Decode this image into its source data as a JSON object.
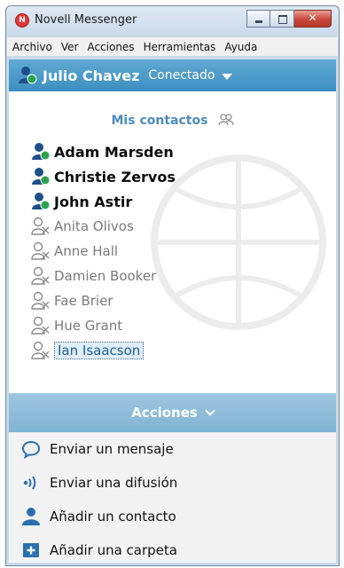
{
  "window": {
    "title": "Novell Messenger",
    "app_icon": "novell-icon"
  },
  "menu": [
    "Archivo",
    "Ver",
    "Acciones",
    "Herramientas",
    "Ayuda"
  ],
  "user": {
    "name": "Julio Chavez",
    "status": "Conectado"
  },
  "contacts": {
    "group_title": "Mis contactos",
    "items": [
      {
        "name": "Adam Marsden",
        "status": "online"
      },
      {
        "name": "Christie Zervos",
        "status": "online"
      },
      {
        "name": "John Astir",
        "status": "online"
      },
      {
        "name": "Anita Olivos",
        "status": "offline"
      },
      {
        "name": "Anne Hall",
        "status": "offline"
      },
      {
        "name": "Damien Booker",
        "status": "offline"
      },
      {
        "name": "Fae Brier",
        "status": "offline"
      },
      {
        "name": "Hue Grant",
        "status": "offline"
      },
      {
        "name": "Ian Isaacson",
        "status": "offline",
        "selected": true
      }
    ]
  },
  "actions": {
    "title": "Acciones",
    "items": [
      {
        "label": "Enviar un mensaje",
        "icon": "chat-bubble-icon"
      },
      {
        "label": "Enviar una difusión",
        "icon": "broadcast-icon"
      },
      {
        "label": "Añadir un contacto",
        "icon": "add-contact-icon"
      },
      {
        "label": "Añadir una carpeta",
        "icon": "add-folder-icon"
      }
    ]
  },
  "colors": {
    "accent": "#3d8ec1",
    "online": "#2ba24c",
    "offline": "#8a8a8a",
    "actions_bar": "#8fbdd9"
  }
}
